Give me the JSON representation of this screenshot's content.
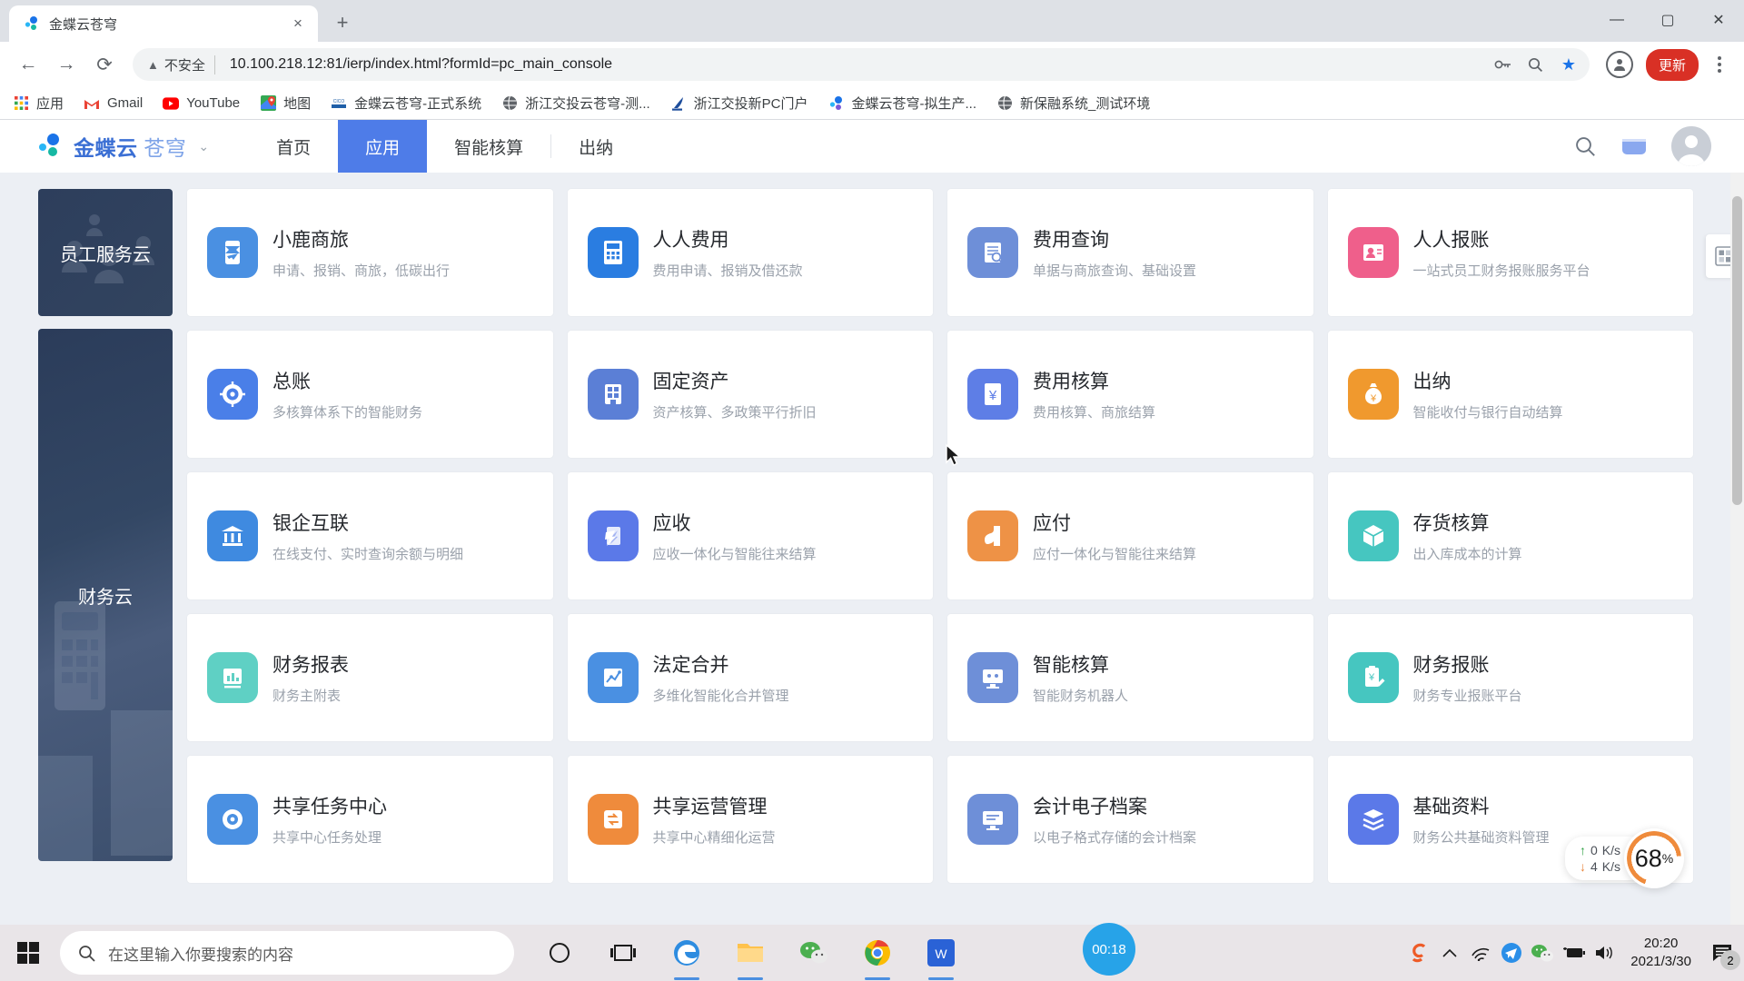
{
  "browser": {
    "tab": {
      "title": "金蝶云苍穹",
      "favicon": "kingdee-dots-icon",
      "close": "×"
    },
    "newtab_label": "+",
    "window_controls": {
      "minimize": "—",
      "maximize": "▢",
      "close": "✕"
    },
    "nav": {
      "back": "←",
      "forward": "→",
      "reload": "⟳"
    },
    "omnibox": {
      "security_icon": "warning-triangle-icon",
      "security_text": "不安全",
      "url": "10.100.218.12:81/ierp/index.html?formId=pc_main_console",
      "key_icon": "key-icon",
      "zoom_icon": "magnifier-icon",
      "bookmark_icon": "star-icon"
    },
    "update_label": "更新",
    "bookmarks": [
      {
        "label": "应用",
        "icon": "apps-grid-icon"
      },
      {
        "label": "Gmail",
        "icon": "gmail-icon"
      },
      {
        "label": "YouTube",
        "icon": "youtube-icon"
      },
      {
        "label": "地图",
        "icon": "maps-icon"
      },
      {
        "label": "金蝶云苍穹-正式系统",
        "icon": "cisco-icon"
      },
      {
        "label": "浙江交投云苍穹-测...",
        "icon": "globe-icon"
      },
      {
        "label": "浙江交投新PC门户",
        "icon": "portal-icon"
      },
      {
        "label": "金蝶云苍穹-拟生产...",
        "icon": "kingdee-dots-icon"
      },
      {
        "label": "新保融系统_测试环境",
        "icon": "globe-icon"
      }
    ]
  },
  "app": {
    "brand": {
      "main": "金蝶云",
      "light": "苍穹",
      "caret": "⌄"
    },
    "nav_items": [
      {
        "label": "首页",
        "active": false
      },
      {
        "label": "应用",
        "active": true
      },
      {
        "label": "智能核算",
        "active": false
      },
      {
        "label": "出纳",
        "active": false
      }
    ],
    "nav_right": {
      "search_icon": "search-icon",
      "message_icon": "inbox-icon",
      "avatar": "user-avatar"
    },
    "side_flag_icon": "panel-toggle-icon",
    "categories": [
      {
        "label": "员工服务云"
      },
      {
        "label": "财务云"
      }
    ],
    "cards": [
      {
        "title": "小鹿商旅",
        "sub": "申请、报销、商旅，低碳出行",
        "color": "#4a90e2",
        "icon": "travel-card-icon"
      },
      {
        "title": "人人费用",
        "sub": "费用申请、报销及借还款",
        "color": "#2a7de1",
        "icon": "calculator-icon"
      },
      {
        "title": "费用查询",
        "sub": "单据与商旅查询、基础设置",
        "color": "#6e8fd8",
        "icon": "document-search-icon"
      },
      {
        "title": "人人报账",
        "sub": "一站式员工财务报账服务平台",
        "color": "#ef5f8b",
        "icon": "person-card-icon"
      },
      {
        "title": "总账",
        "sub": "多核算体系下的智能财务",
        "color": "#4a7fe8",
        "icon": "ledger-icon"
      },
      {
        "title": "固定资产",
        "sub": "资产核算、多政策平行折旧",
        "color": "#5b7fd6",
        "icon": "building-asset-icon"
      },
      {
        "title": "费用核算",
        "sub": "费用核算、商旅结算",
        "color": "#5e7ee6",
        "icon": "yuan-doc-icon"
      },
      {
        "title": "出纳",
        "sub": "智能收付与银行自动结算",
        "color": "#f0992e",
        "icon": "money-bag-icon"
      },
      {
        "title": "银企互联",
        "sub": "在线支付、实时查询余额与明细",
        "color": "#3f8ae0",
        "icon": "bank-icon"
      },
      {
        "title": "应收",
        "sub": "应收一体化与智能往来结算",
        "color": "#5b79e8",
        "icon": "receivable-icon"
      },
      {
        "title": "应付",
        "sub": "应付一体化与智能往来结算",
        "color": "#ee9246",
        "icon": "payable-icon"
      },
      {
        "title": "存货核算",
        "sub": "出入库成本的计算",
        "color": "#46c6c0",
        "icon": "box-icon"
      },
      {
        "title": "财务报表",
        "sub": "财务主附表",
        "color": "#5fd0c4",
        "icon": "chart-report-icon"
      },
      {
        "title": "法定合并",
        "sub": "多维化智能化合并管理",
        "color": "#4a90e2",
        "icon": "merge-chart-icon"
      },
      {
        "title": "智能核算",
        "sub": "智能财务机器人",
        "color": "#6e8fd8",
        "icon": "robot-monitor-icon"
      },
      {
        "title": "财务报账",
        "sub": "财务专业报账平台",
        "color": "#46c6c0",
        "icon": "yuan-clipboard-icon"
      },
      {
        "title": "共享任务中心",
        "sub": "共享中心任务处理",
        "color": "#4a90e2",
        "icon": "task-center-icon"
      },
      {
        "title": "共享运营管理",
        "sub": "共享中心精细化运营",
        "color": "#ef8b3c",
        "icon": "share-ops-icon"
      },
      {
        "title": "会计电子档案",
        "sub": "以电子格式存储的会计档案",
        "color": "#6e8fd8",
        "icon": "archive-monitor-icon"
      },
      {
        "title": "基础资料",
        "sub": "财务公共基础资料管理",
        "color": "#5b79e8",
        "icon": "layers-icon"
      }
    ]
  },
  "netmonitor": {
    "upload": {
      "arrow": "↑",
      "value": "0",
      "unit": "K/s"
    },
    "download": {
      "arrow": "↓",
      "value": "4",
      "unit": "K/s"
    },
    "cpu_value": "68",
    "cpu_unit": "%"
  },
  "taskbar": {
    "start_icon": "windows-start-icon",
    "search_placeholder": "在这里输入你要搜索的内容",
    "search_icon": "search-icon",
    "icons": [
      {
        "name": "cortana-circle-icon"
      },
      {
        "name": "task-view-icon"
      },
      {
        "name": "edge-icon"
      },
      {
        "name": "file-explorer-icon"
      },
      {
        "name": "wechat-icon"
      },
      {
        "name": "chrome-icon"
      },
      {
        "name": "wps-icon"
      }
    ],
    "timer_label": "00:18",
    "tray": {
      "sogou_icon": "sogou-icon",
      "chevron_icon": "chevron-up-icon",
      "wifi_icon": "wifi-icon",
      "send_icon": "telegram-icon",
      "wechat_icon": "wechat-icon",
      "battery_icon": "battery-charging-icon",
      "volume_icon": "volume-icon"
    },
    "time": "20:20",
    "date": "2021/3/30",
    "notification_count": "2"
  }
}
